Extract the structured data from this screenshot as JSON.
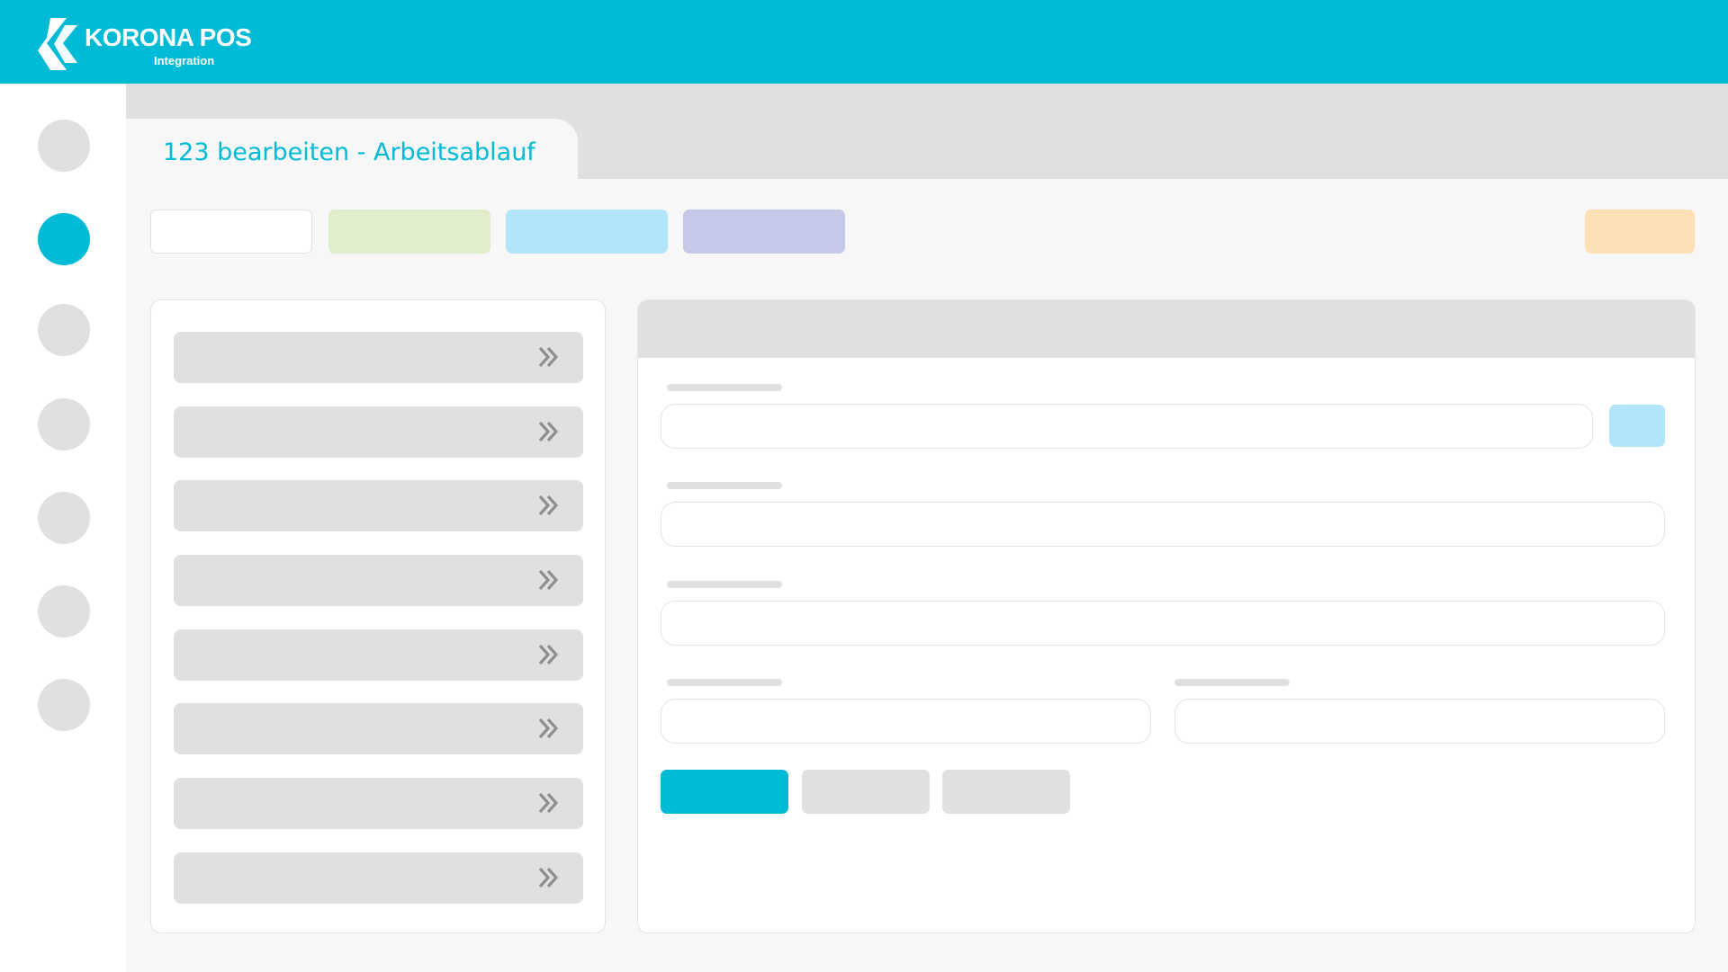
{
  "header": {
    "brand_name": "KORONA POS",
    "brand_sub": "Integration",
    "background": "#00bad6",
    "logo_icon": "korona-chevron-logo"
  },
  "sidebar": {
    "items": [
      {
        "name": "nav-item-1",
        "active": false
      },
      {
        "name": "nav-item-2",
        "active": true
      },
      {
        "name": "nav-item-3",
        "active": false
      },
      {
        "name": "nav-item-4",
        "active": false
      },
      {
        "name": "nav-item-5",
        "active": false
      },
      {
        "name": "nav-item-6",
        "active": false
      },
      {
        "name": "nav-item-7",
        "active": false
      }
    ],
    "active_color": "#00bad6",
    "inactive_color": "#e0e0e0"
  },
  "tab": {
    "title": "123 bearbeiten - Arbeitsablauf"
  },
  "toolbar": {
    "buttons": [
      {
        "name": "toolbar-button-white",
        "color": "#ffffff"
      },
      {
        "name": "toolbar-button-green",
        "color": "#dfedcb"
      },
      {
        "name": "toolbar-button-blue",
        "color": "#b3e5fa"
      },
      {
        "name": "toolbar-button-purple",
        "color": "#c5c9e7"
      },
      {
        "name": "toolbar-button-orange",
        "color": "#fde0b6"
      }
    ]
  },
  "list": {
    "items": 8,
    "item_icon": "double-chevron-right-icon"
  },
  "form": {
    "side_button_color": "#b3e5fa",
    "actions": [
      {
        "name": "primary-action-button",
        "color": "#00bad6"
      },
      {
        "name": "secondary-action-button",
        "color": "#e0e0e0"
      },
      {
        "name": "tertiary-action-button",
        "color": "#e0e0e0"
      }
    ]
  }
}
